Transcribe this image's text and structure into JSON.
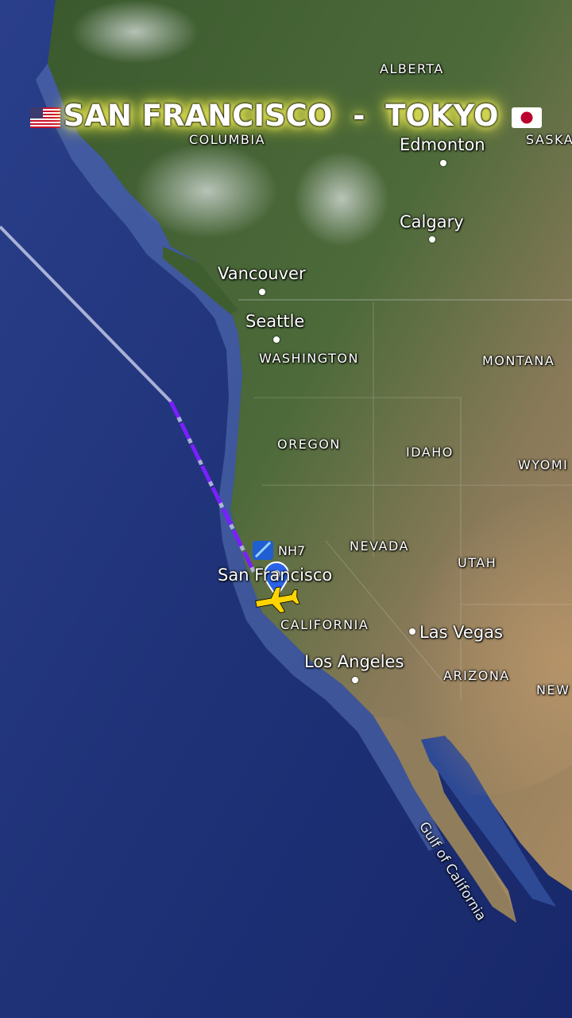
{
  "header": {
    "origin": "SAN FRANCISCO",
    "separator": "-",
    "destination": "TOKYO",
    "origin_flag_icon": "us-flag-icon",
    "destination_flag_icon": "japan-flag-icon"
  },
  "flight": {
    "callsign": "NH7",
    "route_color": "#7a1fff",
    "track_color": "#b8bfe0"
  },
  "places": {
    "alberta": "ALBERTA",
    "edmonton": "Edmonton",
    "saskatchewan": "SASKA",
    "columbia": "COLUMBIA",
    "calgary": "Calgary",
    "vancouver": "Vancouver",
    "seattle": "Seattle",
    "washington": "WASHINGTON",
    "montana": "MONTANA",
    "oregon": "OREGON",
    "idaho": "IDAHO",
    "wyoming": "WYOMI",
    "nevada": "NEVADA",
    "utah": "UTAH",
    "san_francisco": "San Francisco",
    "california": "CALIFORNIA",
    "las_vegas": "Las Vegas",
    "los_angeles": "Los Angeles",
    "arizona": "ARIZONA",
    "new_mexico": "NEW",
    "gulf_of_california": "Gulf of California"
  },
  "colors": {
    "ocean": "#1f3278",
    "land": "#3c5a2a",
    "desert": "#a89070",
    "glow": "#ffff55"
  }
}
